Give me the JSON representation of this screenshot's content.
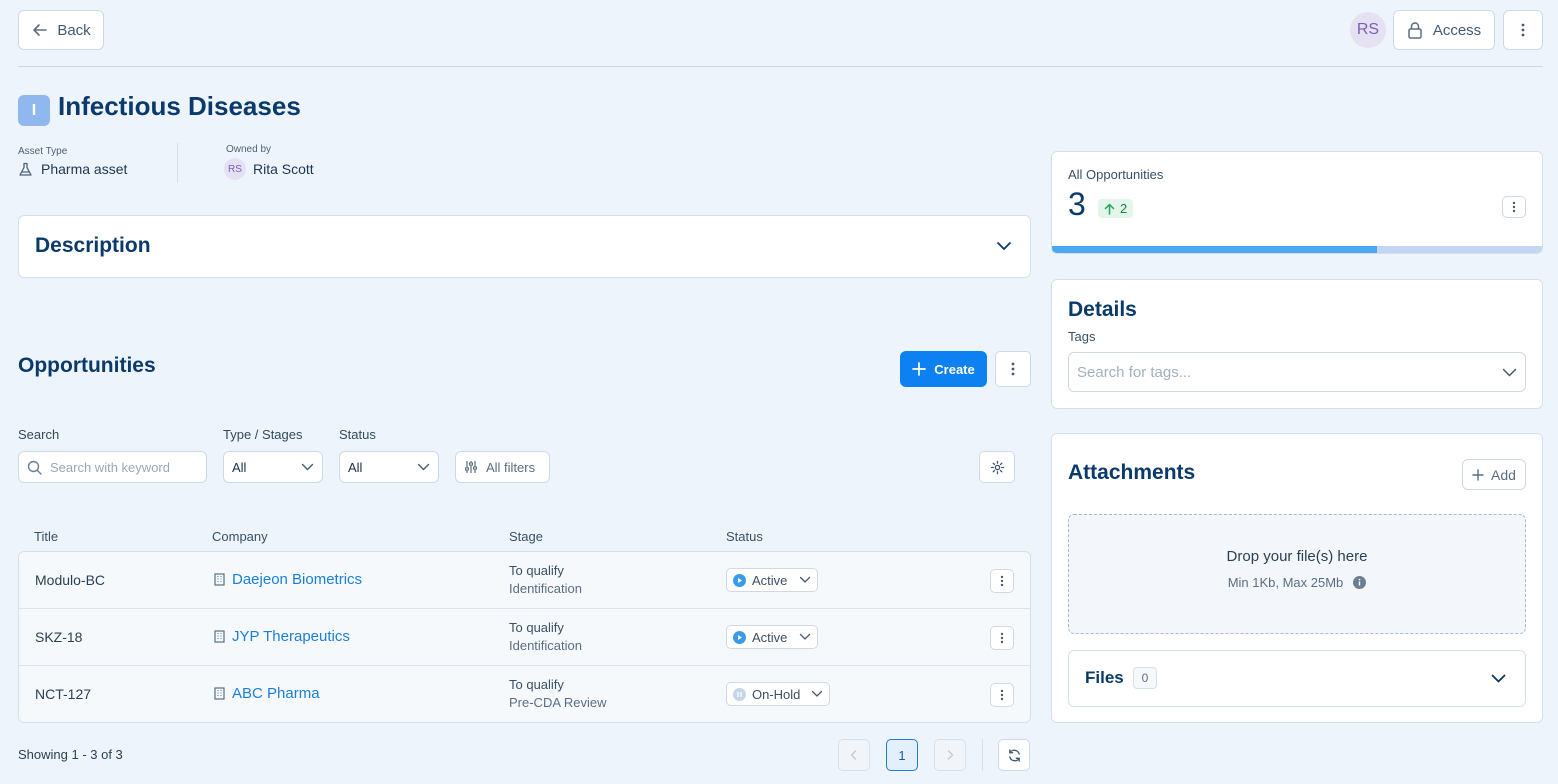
{
  "header": {
    "back_label": "Back",
    "avatar_initials": "RS",
    "access_label": "Access"
  },
  "asset": {
    "icon_letter": "I",
    "title": "Infectious Diseases",
    "asset_type_label": "Asset Type",
    "asset_type_value": "Pharma asset",
    "owned_by_label": "Owned by",
    "owner_initials": "RS",
    "owner_name": "Rita Scott"
  },
  "description": {
    "title": "Description"
  },
  "opportunities": {
    "title": "Opportunities",
    "create_label": "Create",
    "filters": {
      "search_label": "Search",
      "search_placeholder": "Search with keyword",
      "type_label": "Type / Stages",
      "type_value": "All",
      "status_label": "Status",
      "status_value": "All",
      "all_filters_label": "All filters"
    },
    "columns": [
      "Title",
      "Company",
      "Stage",
      "Status"
    ],
    "rows": [
      {
        "title": "Modulo-BC",
        "company": "Daejeon Biometrics",
        "stage": "To qualify",
        "substage": "Identification",
        "status": "Active"
      },
      {
        "title": "SKZ-18",
        "company": "JYP Therapeutics",
        "stage": "To qualify",
        "substage": "Identification",
        "status": "Active"
      },
      {
        "title": "NCT-127",
        "company": "ABC Pharma",
        "stage": "To qualify",
        "substage": "Pre-CDA Review",
        "status": "On-Hold"
      }
    ],
    "showing": "Showing 1 - 3 of 3",
    "page": "1"
  },
  "stats": {
    "label": "All Opportunities",
    "count": "3",
    "delta": "2",
    "progress_fraction": 0.66
  },
  "details": {
    "title": "Details",
    "tags_label": "Tags",
    "tags_placeholder": "Search for tags..."
  },
  "attachments": {
    "title": "Attachments",
    "add_label": "Add",
    "drop_label": "Drop your file(s) here",
    "limits": "Min 1Kb, Max 25Mb",
    "files_label": "Files",
    "files_count": "0"
  },
  "colors": {
    "primary": "#0d80f2",
    "navy": "#0a3a6b",
    "link": "#1b7fd8",
    "progress": "#4aa8f0",
    "progress_track": "#c3d6f3"
  }
}
